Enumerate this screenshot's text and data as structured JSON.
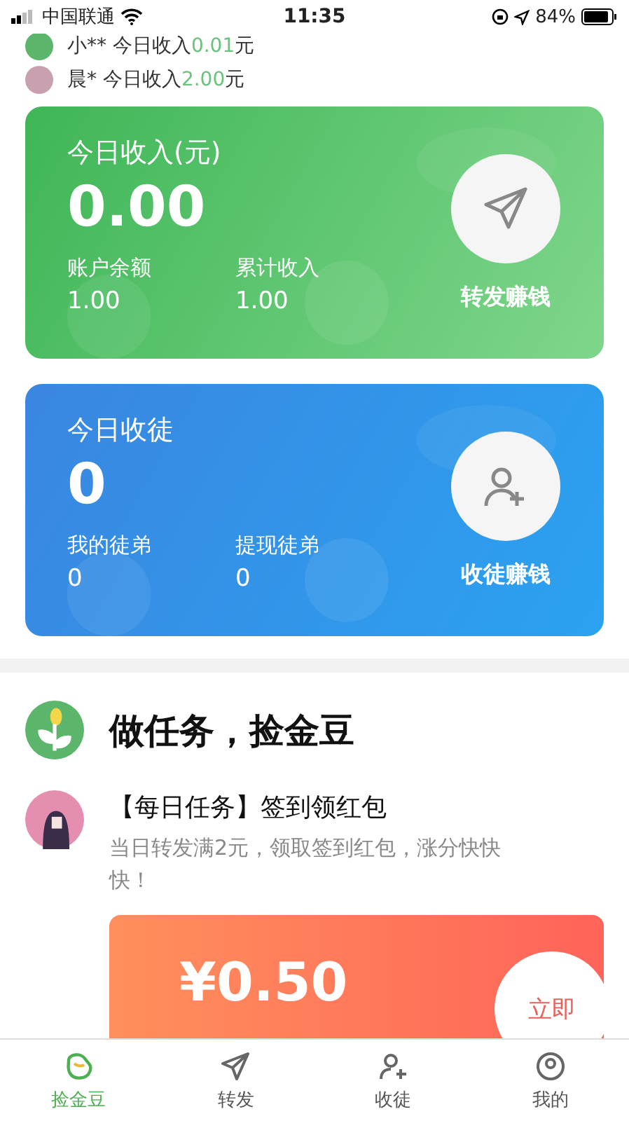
{
  "status_bar": {
    "carrier": "中国联通",
    "time": "11:35",
    "battery": "84%"
  },
  "ticker": [
    {
      "name": "小**",
      "text": " 今日收入",
      "amount": "0.01",
      "unit": "元"
    },
    {
      "name": "晨*",
      "text": " 今日收入",
      "amount": "2.00",
      "unit": "元"
    }
  ],
  "income_card": {
    "title": "今日收入(元)",
    "value": "0.00",
    "stats": [
      {
        "label": "账户余额",
        "value": "1.00"
      },
      {
        "label": "累计收入",
        "value": "1.00"
      }
    ],
    "action": "转发赚钱"
  },
  "apprentice_card": {
    "title": "今日收徒",
    "value": "0",
    "stats": [
      {
        "label": "我的徒弟",
        "value": "0"
      },
      {
        "label": "提现徒弟",
        "value": "0"
      }
    ],
    "action": "收徒赚钱"
  },
  "section": {
    "title": "做任务，捡金豆"
  },
  "task": {
    "title": "【每日任务】签到领红包",
    "description": "当日转发满2元，领取签到红包，涨分快快快！",
    "reward": "¥0.50",
    "button": "立即"
  },
  "tabs": [
    {
      "label": "捡金豆",
      "selected": true,
      "kind": "bean"
    },
    {
      "label": "转发",
      "selected": false,
      "kind": "send"
    },
    {
      "label": "收徒",
      "selected": false,
      "kind": "person"
    },
    {
      "label": "我的",
      "selected": false,
      "kind": "me"
    }
  ]
}
